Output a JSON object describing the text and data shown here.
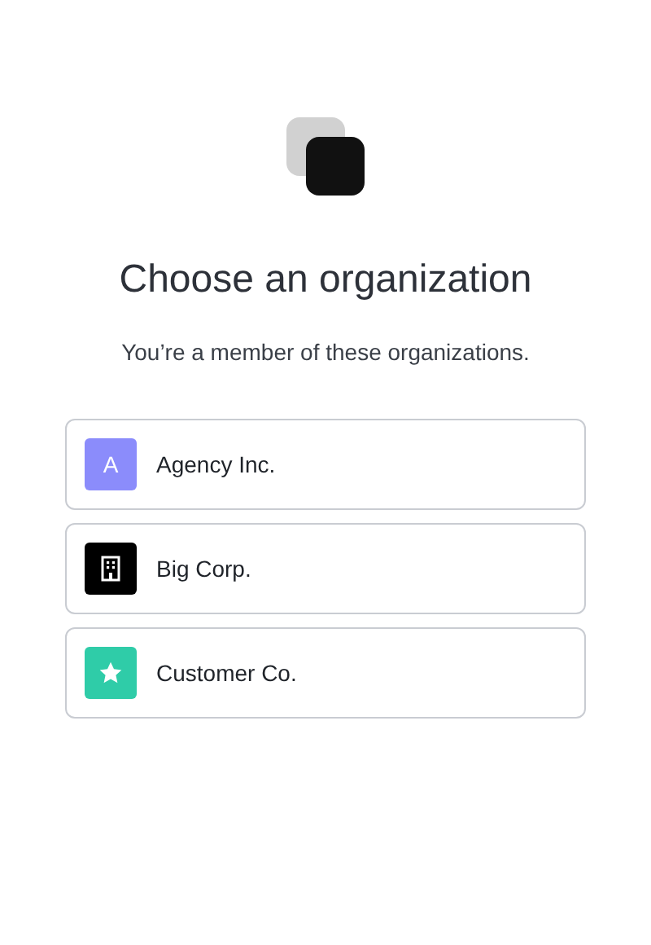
{
  "title": "Choose an organization",
  "subtitle": "You’re a member of these organizations.",
  "organizations": [
    {
      "name": "Agency Inc.",
      "kind": "letter",
      "letter": "A",
      "color": "#8b8cfb"
    },
    {
      "name": "Big Corp.",
      "kind": "building",
      "color": "#000000"
    },
    {
      "name": "Customer Co.",
      "kind": "star",
      "color": "#2fcca8"
    }
  ]
}
